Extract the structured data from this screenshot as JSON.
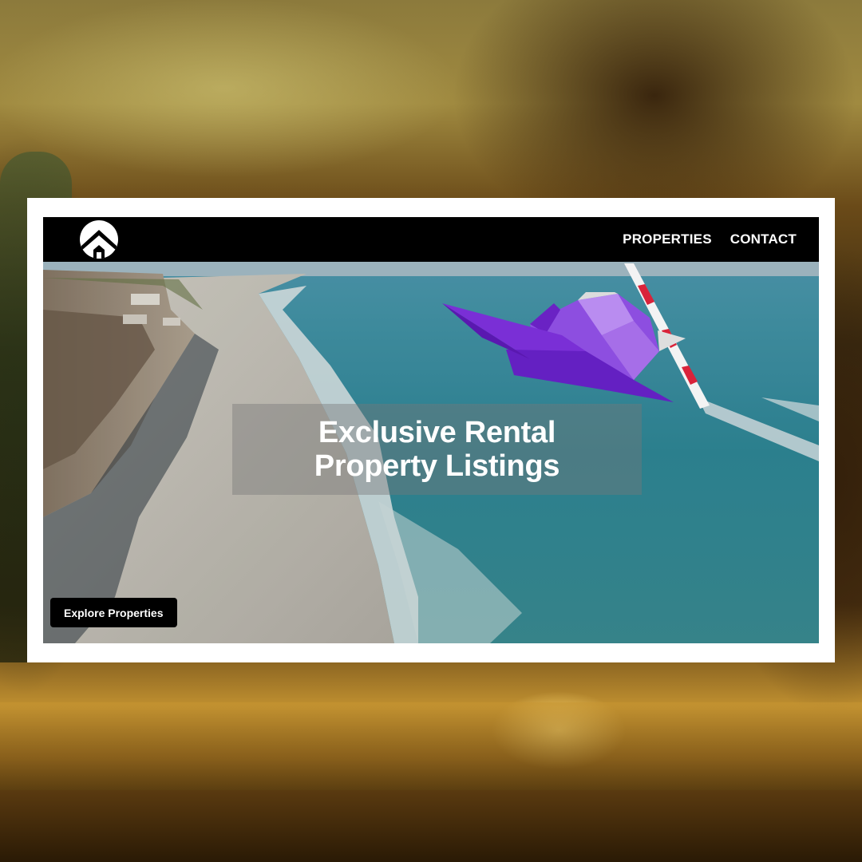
{
  "nav": {
    "logo_icon": "house-logo-icon",
    "links": [
      {
        "label": "PROPERTIES"
      },
      {
        "label": "CONTACT"
      }
    ]
  },
  "hero": {
    "headline_line1": "Exclusive Rental",
    "headline_line2": "Property Listings",
    "cta_label": "Explore Properties",
    "background_image": "aerial beach coastline",
    "decoration_icon": "airplane-icon"
  },
  "colors": {
    "nav_bg": "#000000",
    "cta_bg": "#000000",
    "frame": "#ffffff",
    "plane": "#7b2fd6"
  }
}
